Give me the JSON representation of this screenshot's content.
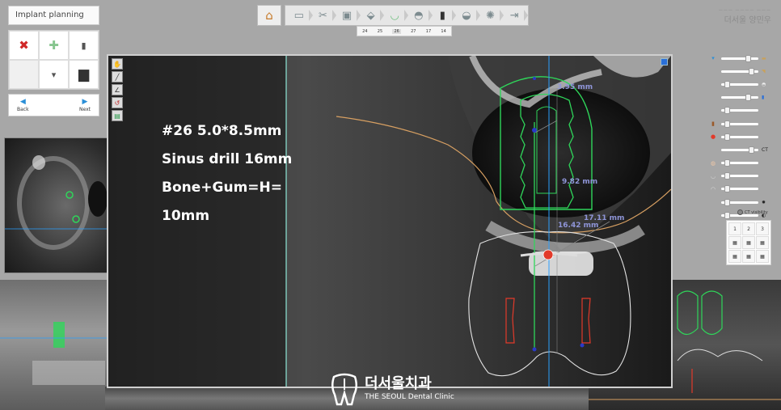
{
  "panel": {
    "title": "Implant planning",
    "back_label": "Back",
    "next_label": "Next"
  },
  "toolbar": {
    "tooth_numbers": [
      "24",
      "25",
      "26",
      "27",
      "17",
      "14"
    ],
    "selected_tooth": "26"
  },
  "clinic": {
    "small_line": "——— ———— ———",
    "name": "더서울 양민우"
  },
  "controls": {
    "ct_label": "CT",
    "visibility_label": "CT visibility",
    "view_numbers": [
      "1",
      "2",
      "3"
    ]
  },
  "viewer": {
    "note_lines": [
      "#26 5.0*8.5mm",
      "Sinus drill 16mm",
      "Bone+Gum=H=",
      "10mm"
    ],
    "measurements": [
      "3.95 mm",
      "9.82 mm",
      "17.11 mm",
      "16.42 mm"
    ]
  },
  "watermark": {
    "name_ko": "더서울치과",
    "name_en": "THE SEOUL Dental Clinic"
  },
  "colors": {
    "implant": "#2fd65a",
    "axis": "#2aa0ff",
    "marker": "#e23a2a",
    "measure": "#8f95d8",
    "nerve": "#d8a062"
  }
}
